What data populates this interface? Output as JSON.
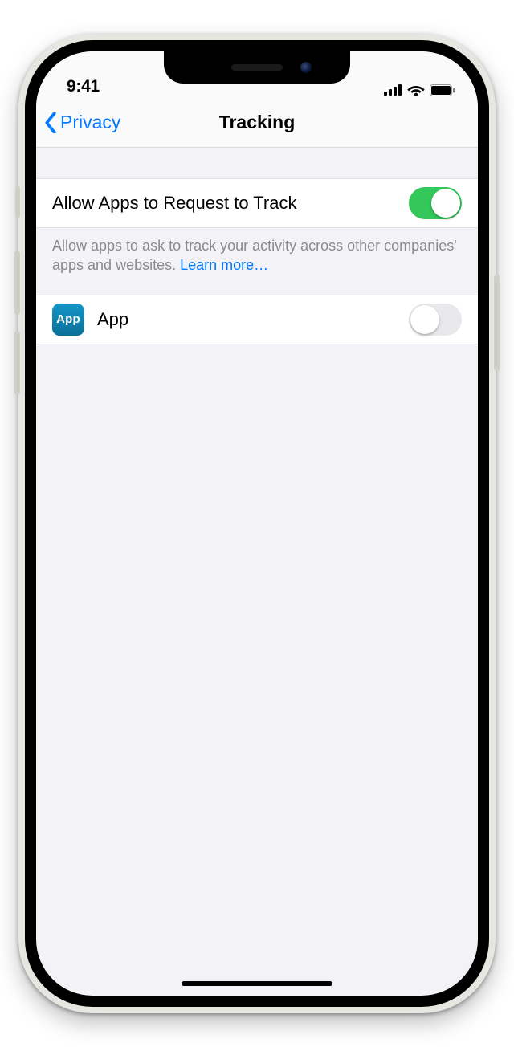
{
  "status": {
    "time": "9:41"
  },
  "nav": {
    "back_label": "Privacy",
    "title": "Tracking"
  },
  "settings": {
    "allow_request": {
      "label": "Allow Apps to Request to Track",
      "enabled": true,
      "footer_text": "Allow apps to ask to track your activity across other companies' apps and websites. ",
      "learn_more_label": "Learn more…"
    },
    "apps": [
      {
        "name": "App",
        "icon_text": "App",
        "enabled": false
      }
    ]
  },
  "colors": {
    "tint": "#007aff",
    "toggle_on": "#34c759",
    "background": "#f2f2f7"
  }
}
